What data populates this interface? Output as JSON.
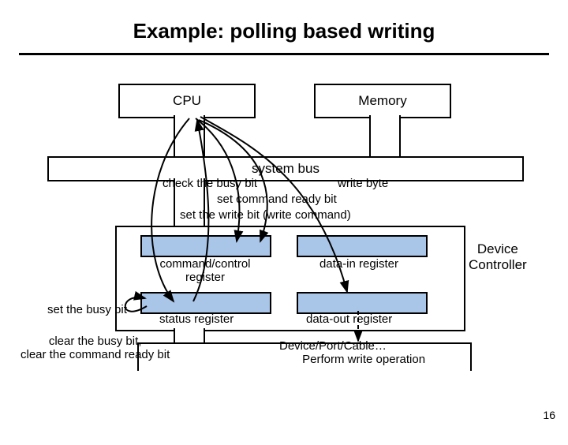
{
  "title": "Example: polling based writing",
  "blocks": {
    "cpu": "CPU",
    "memory": "Memory",
    "system_bus": "system bus",
    "device_controller": "Device\nController",
    "cmd_ctrl_reg": "command/control\nregister",
    "data_in_reg": "data-in register",
    "status_reg": "status register",
    "data_out_reg": "data-out register"
  },
  "annotations": {
    "check_busy": "check the busy bit",
    "write_byte": "write byte",
    "set_cmd_ready": "set command ready bit",
    "set_write_bit": "set the write bit (write command)",
    "set_busy": "set the busy bit",
    "clear_busy": "clear the busy bit,\nclear the command ready bit",
    "perform_write": "Device/Port/Cable…\n       Perform write operation"
  },
  "page_number": "16"
}
